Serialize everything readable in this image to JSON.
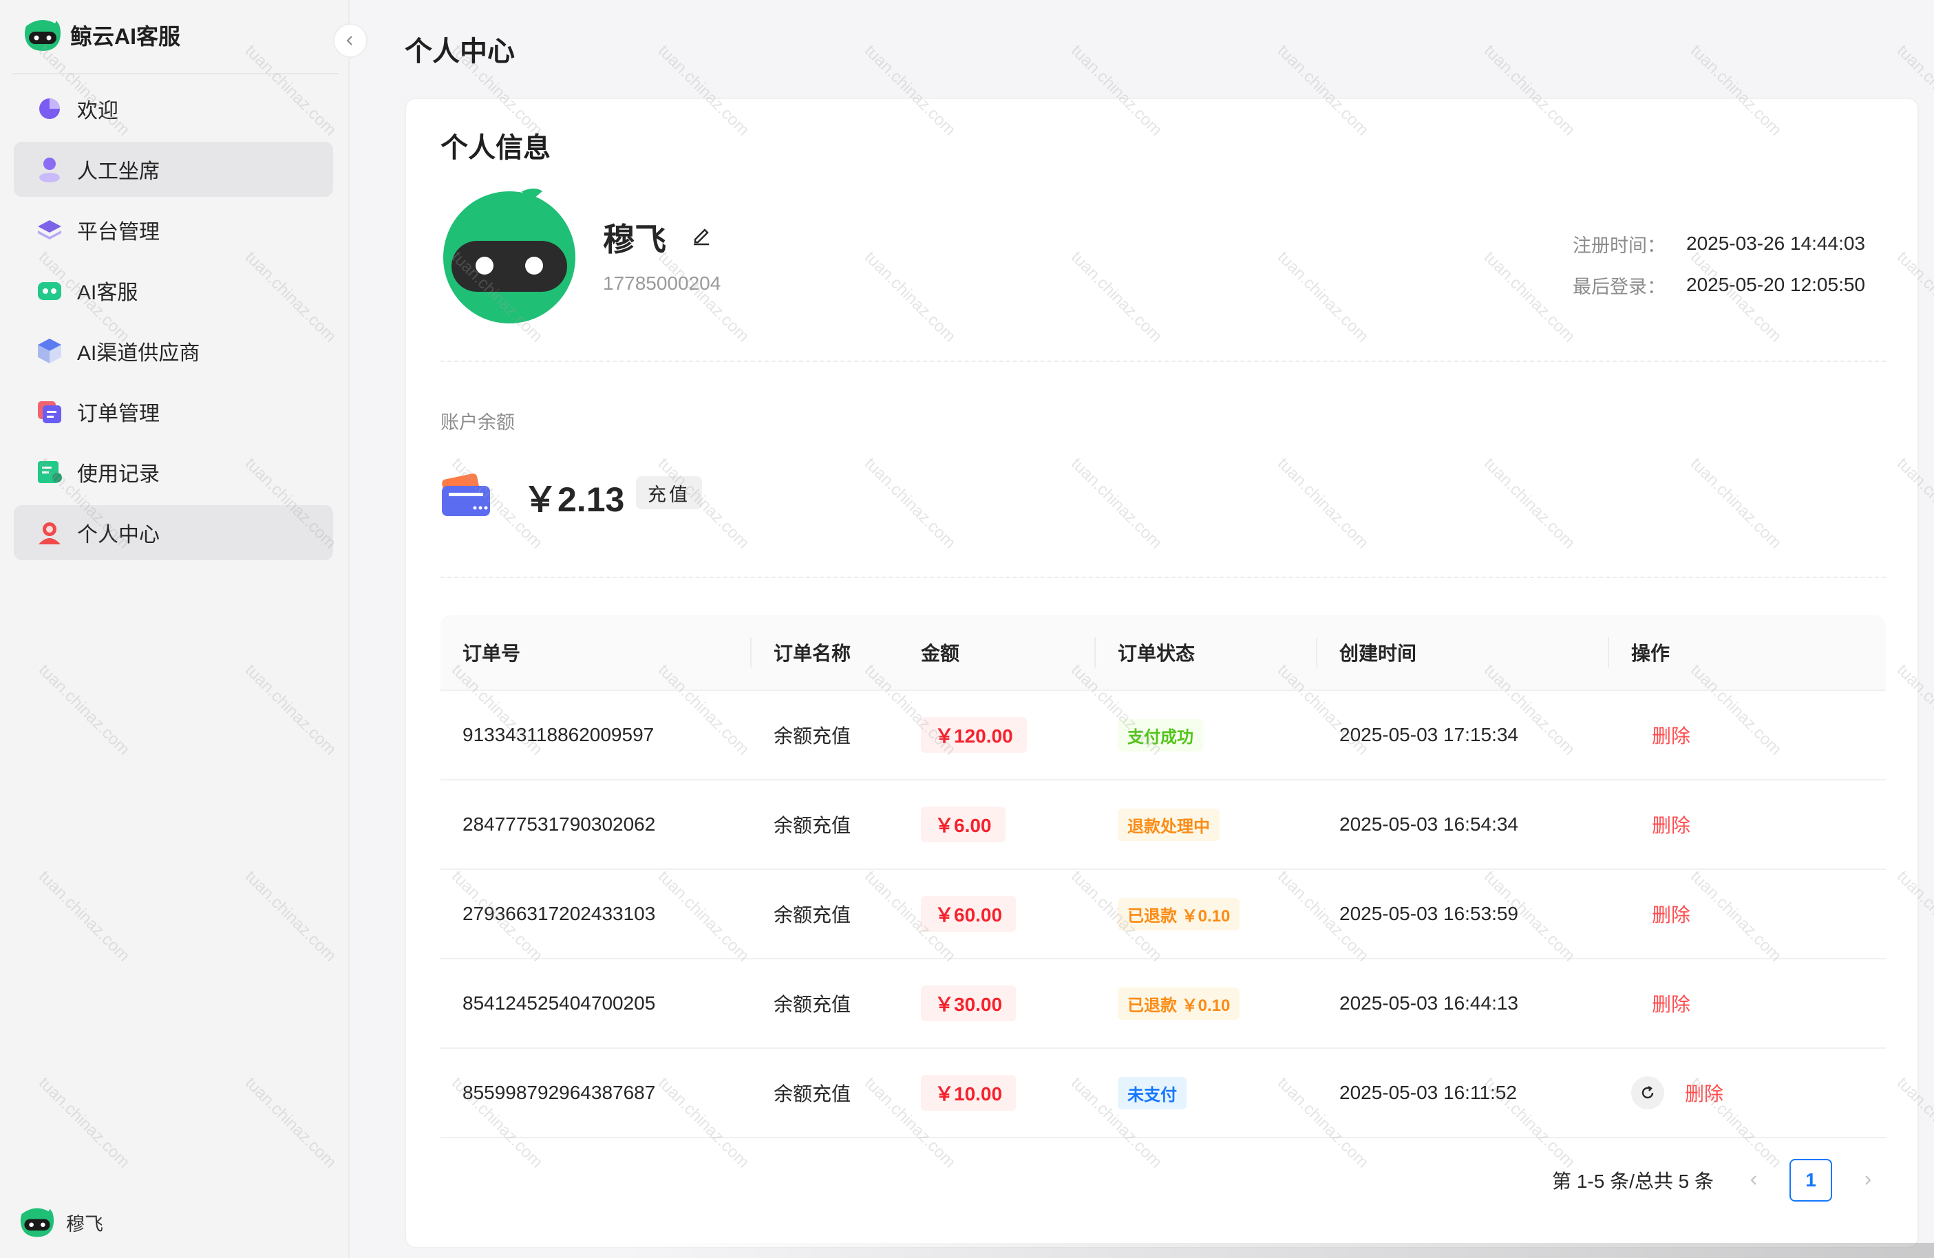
{
  "app": {
    "name": "鲸云AI客服"
  },
  "sidebar": {
    "items": [
      {
        "label": "欢迎",
        "icon": "pie-chart-icon",
        "active": false
      },
      {
        "label": "人工坐席",
        "icon": "person-icon",
        "active": true
      },
      {
        "label": "平台管理",
        "icon": "layers-icon",
        "active": false
      },
      {
        "label": "AI客服",
        "icon": "robot-icon",
        "active": false
      },
      {
        "label": "AI渠道供应商",
        "icon": "cube-icon",
        "active": false
      },
      {
        "label": "订单管理",
        "icon": "order-cards-icon",
        "active": false
      },
      {
        "label": "使用记录",
        "icon": "record-doc-icon",
        "active": false
      },
      {
        "label": "个人中心",
        "icon": "user-center-icon",
        "active": true
      }
    ],
    "user_name": "穆飞"
  },
  "page": {
    "title": "个人中心"
  },
  "profile": {
    "card_title": "个人信息",
    "name": "穆飞",
    "phone": "17785000204",
    "register_label": "注册时间：",
    "register_time": "2025-03-26 14:44:03",
    "last_login_label": "最后登录：",
    "last_login_time": "2025-05-20 12:05:50"
  },
  "balance": {
    "label": "账户余额",
    "amount": "￥2.13",
    "recharge_label": "充值"
  },
  "orders": {
    "columns": [
      "订单号",
      "订单名称",
      "金额",
      "订单状态",
      "创建时间",
      "操作"
    ],
    "rows": [
      {
        "id": "913343118862009597",
        "name": "余额充值",
        "amount": "￥120.00",
        "status": "支付成功",
        "status_type": "success",
        "created": "2025-05-03 17:15:34",
        "action": "删除",
        "has_refresh": false
      },
      {
        "id": "284777531790302062",
        "name": "余额充值",
        "amount": "￥6.00",
        "status": "退款处理中",
        "status_type": "warn",
        "created": "2025-05-03 16:54:34",
        "action": "删除",
        "has_refresh": false
      },
      {
        "id": "279366317202433103",
        "name": "余额充值",
        "amount": "￥60.00",
        "status": "已退款 ￥0.10",
        "status_type": "warn",
        "created": "2025-05-03 16:53:59",
        "action": "删除",
        "has_refresh": false
      },
      {
        "id": "854124525404700205",
        "name": "余额充值",
        "amount": "￥30.00",
        "status": "已退款 ￥0.10",
        "status_type": "warn",
        "created": "2025-05-03 16:44:13",
        "action": "删除",
        "has_refresh": false
      },
      {
        "id": "855998792964387687",
        "name": "余额充值",
        "amount": "￥10.00",
        "status": "未支付",
        "status_type": "info",
        "created": "2025-05-03 16:11:52",
        "action": "删除",
        "has_refresh": true
      }
    ],
    "pagination": {
      "total_text": "第 1-5 条/总共 5 条",
      "current_page": "1"
    }
  },
  "watermark": {
    "text": "tuan.chinaz.com"
  },
  "colors": {
    "accent": "#1677ff",
    "danger": "#ff4d4f",
    "brand_green": "#16c784"
  }
}
